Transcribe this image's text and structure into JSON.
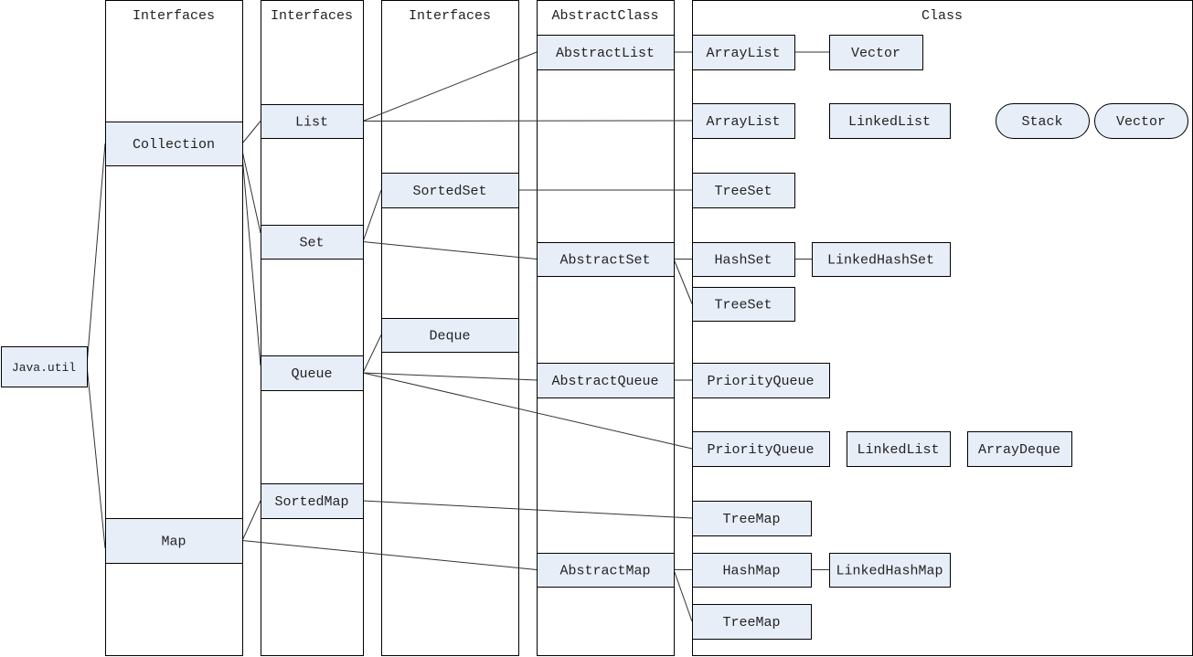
{
  "colors": {
    "node_fill": "#e8eef8",
    "stroke": "#000000",
    "line": "#333333"
  },
  "columns": [
    {
      "id": "col1",
      "header": "Interfaces"
    },
    {
      "id": "col2",
      "header": "Interfaces"
    },
    {
      "id": "col3",
      "header": "Interfaces"
    },
    {
      "id": "col4",
      "header": "AbstractClass"
    },
    {
      "id": "col5",
      "header": "Class"
    }
  ],
  "nodes": {
    "java": "Java.util",
    "collection": "Collection",
    "map": "Map",
    "list": "List",
    "set": "Set",
    "queue": "Queue",
    "sortedmap": "SortedMap",
    "sortedset": "SortedSet",
    "deque": "Deque",
    "abstractlist": "AbstractList",
    "abstractset": "AbstractSet",
    "abstractqueue": "AbstractQueue",
    "abstractmap": "AbstractMap",
    "arraylist1": "ArrayList",
    "vector1": "Vector",
    "arraylist2": "ArrayList",
    "linkedlist1": "LinkedList",
    "stack": "Stack",
    "vector2": "Vector",
    "treeset1": "TreeSet",
    "hashset": "HashSet",
    "linkedhashset": "LinkedHashSet",
    "treeset2": "TreeSet",
    "priorityqueue1": "PriorityQueue",
    "priorityqueue2": "PriorityQueue",
    "linkedlist2": "LinkedList",
    "arraydeque": "ArrayDeque",
    "treemap1": "TreeMap",
    "hashmap": "HashMap",
    "linkedhashmap": "LinkedHashMap",
    "treemap2": "TreeMap"
  },
  "edges": [
    [
      "java",
      "collection"
    ],
    [
      "java",
      "map"
    ],
    [
      "collection",
      "list"
    ],
    [
      "collection",
      "set"
    ],
    [
      "collection",
      "queue"
    ],
    [
      "map",
      "sortedmap"
    ],
    [
      "map",
      "abstractmap"
    ],
    [
      "list",
      "abstractlist"
    ],
    [
      "list",
      "arraylist2"
    ],
    [
      "set",
      "sortedset"
    ],
    [
      "set",
      "abstractset"
    ],
    [
      "sortedset",
      "treeset1"
    ],
    [
      "queue",
      "deque"
    ],
    [
      "queue",
      "abstractqueue"
    ],
    [
      "queue",
      "priorityqueue2"
    ],
    [
      "sortedmap",
      "treemap1"
    ],
    [
      "abstractlist",
      "arraylist1"
    ],
    [
      "arraylist1",
      "vector1"
    ],
    [
      "abstractset",
      "hashset"
    ],
    [
      "abstractset",
      "treeset2"
    ],
    [
      "hashset",
      "linkedhashset"
    ],
    [
      "abstractqueue",
      "priorityqueue1"
    ],
    [
      "abstractmap",
      "hashmap"
    ],
    [
      "abstractmap",
      "treemap2"
    ],
    [
      "hashmap",
      "linkedhashmap"
    ]
  ]
}
